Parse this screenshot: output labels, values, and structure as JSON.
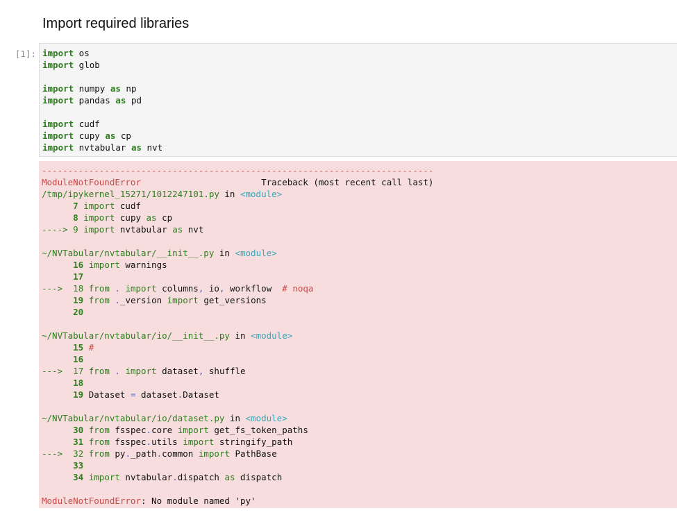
{
  "markdown": {
    "heading": "Import required libraries"
  },
  "code_cell": {
    "prompt": "[1]:",
    "lines": [
      "import os",
      "import glob",
      "",
      "import numpy as np",
      "import pandas as pd",
      "",
      "import cudf",
      "import cupy as cp",
      "import nvtabular as nvt"
    ]
  },
  "output": {
    "separator": "---------------------------------------------------------------------------",
    "error_name": "ModuleNotFoundError",
    "traceback_label": "Traceback (most recent call last)",
    "module_tag": "<module>",
    "in_word": "in",
    "frames": [
      {
        "path": "/tmp/ipykernel_15271/1012247101.py",
        "lines": [
          {
            "arrow": "",
            "num": "7",
            "code": "import cudf"
          },
          {
            "arrow": "",
            "num": "8",
            "code": "import cupy as cp"
          },
          {
            "arrow": "---->",
            "num": "9",
            "code": "import nvtabular as nvt"
          }
        ]
      },
      {
        "path": "~/NVTabular/nvtabular/__init__.py",
        "lines": [
          {
            "arrow": "",
            "num": "16",
            "code": "import warnings"
          },
          {
            "arrow": "",
            "num": "17",
            "code": ""
          },
          {
            "arrow": "--->",
            "num": "18",
            "code": "from . import columns, io, workflow  # noqa"
          },
          {
            "arrow": "",
            "num": "19",
            "code": "from ._version import get_versions"
          },
          {
            "arrow": "",
            "num": "20",
            "code": ""
          }
        ]
      },
      {
        "path": "~/NVTabular/nvtabular/io/__init__.py",
        "lines": [
          {
            "arrow": "",
            "num": "15",
            "code": "#"
          },
          {
            "arrow": "",
            "num": "16",
            "code": ""
          },
          {
            "arrow": "--->",
            "num": "17",
            "code": "from . import dataset, shuffle"
          },
          {
            "arrow": "",
            "num": "18",
            "code": ""
          },
          {
            "arrow": "",
            "num": "19",
            "code": "Dataset = dataset.Dataset"
          }
        ]
      },
      {
        "path": "~/NVTabular/nvtabular/io/dataset.py",
        "lines": [
          {
            "arrow": "",
            "num": "30",
            "code": "from fsspec.core import get_fs_token_paths"
          },
          {
            "arrow": "",
            "num": "31",
            "code": "from fsspec.utils import stringify_path"
          },
          {
            "arrow": "--->",
            "num": "32",
            "code": "from py._path.common import PathBase"
          },
          {
            "arrow": "",
            "num": "33",
            "code": ""
          },
          {
            "arrow": "",
            "num": "34",
            "code": "import nvtabular.dispatch as dispatch"
          }
        ]
      }
    ],
    "final_message": "No module named 'py'"
  },
  "colors": {
    "keyword": "#2e7d1f",
    "error": "#c94848",
    "module_tag": "#3aa6b9",
    "operator": "#4a5ec7",
    "output_bg": "#f7dddd",
    "code_bg": "#f5f5f5"
  }
}
